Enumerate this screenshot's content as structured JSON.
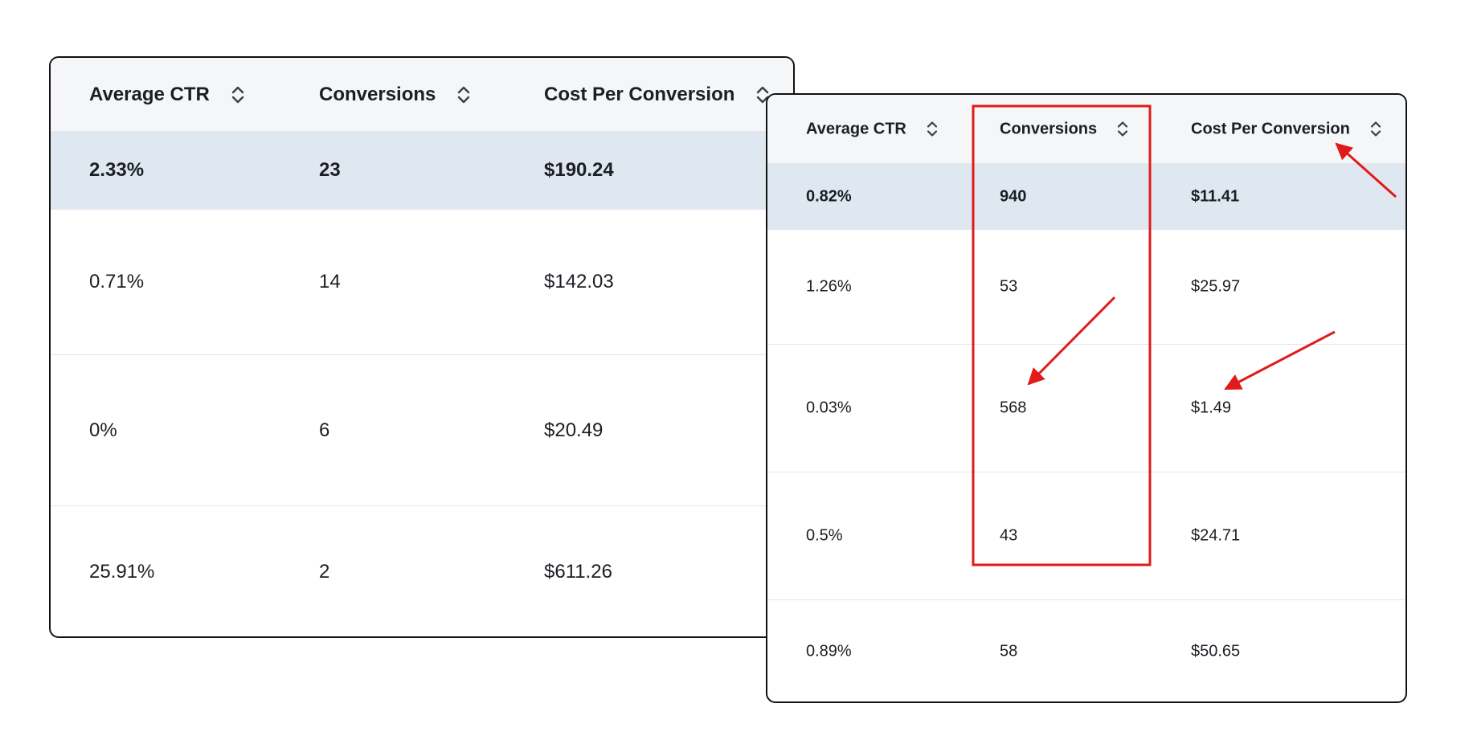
{
  "left_table": {
    "columns": [
      "Average CTR",
      "Conversions",
      "Cost Per Conversion"
    ],
    "rows": [
      [
        "2.33%",
        "23",
        "$190.24"
      ],
      [
        "0.71%",
        "14",
        "$142.03"
      ],
      [
        "0%",
        "6",
        "$20.49"
      ],
      [
        "25.91%",
        "2",
        "$611.26"
      ]
    ]
  },
  "right_table": {
    "columns": [
      "Average CTR",
      "Conversions",
      "Cost Per Conversion"
    ],
    "rows": [
      [
        "0.82%",
        "940",
        "$11.41"
      ],
      [
        "1.26%",
        "53",
        "$25.97"
      ],
      [
        "0.03%",
        "568",
        "$1.49"
      ],
      [
        "0.5%",
        "43",
        "$24.71"
      ],
      [
        "0.89%",
        "58",
        "$50.65"
      ]
    ]
  },
  "icons": {
    "sort": "sort-icon"
  },
  "colors": {
    "header_bg": "#f4f6f8",
    "highlight_row_bg": "#dfe8f1",
    "annotation_red": "#e11a1a",
    "border": "#111111"
  }
}
